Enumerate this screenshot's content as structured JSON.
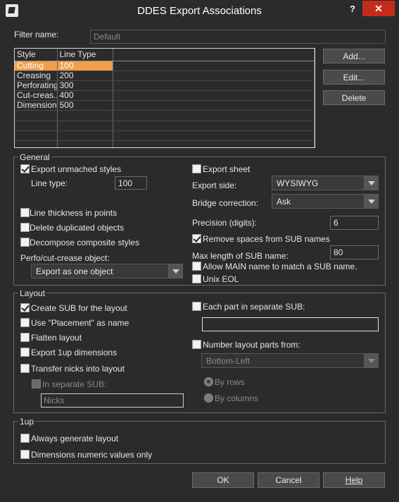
{
  "window": {
    "title": "DDES Export Associations",
    "help_glyph": "?",
    "close_glyph": "✕"
  },
  "filter": {
    "label": "Filter name:",
    "value": "Default"
  },
  "table": {
    "headers": [
      "Style",
      "Line Type"
    ],
    "rows": [
      {
        "style": "Cutting",
        "line_type": "100",
        "selected": true
      },
      {
        "style": "Creasing",
        "line_type": "200"
      },
      {
        "style": "Perforating",
        "line_type": "300"
      },
      {
        "style": "Cut-creas...",
        "line_type": "400"
      },
      {
        "style": "Dimensions",
        "line_type": "500"
      }
    ]
  },
  "side_buttons": {
    "add": "Add...",
    "edit": "Edit...",
    "delete": "Delete"
  },
  "general": {
    "title": "General",
    "export_unmatched": "Export unmached styles",
    "line_type_label": "Line type:",
    "line_type_value": "100",
    "line_thickness": "Line thickness in points",
    "delete_duplicated": "Delete duplicated objects",
    "decompose": "Decompose composite styles",
    "perfo_label": "Perfo/cut-crease object:",
    "perfo_value": "Export as one object",
    "export_sheet": "Export sheet",
    "export_side_label": "Export side:",
    "export_side_value": "WYSIWYG",
    "bridge_label": "Bridge correction:",
    "bridge_value": "Ask",
    "precision_label": "Precision (digits):",
    "precision_value": "6",
    "remove_spaces": "Remove spaces from SUB names",
    "max_length_label": "Max length of SUB name:",
    "max_length_value": "80",
    "allow_main": "Allow MAIN name to match a SUB name.",
    "unix_eol": "Unix EOL"
  },
  "layout": {
    "title": "Layout",
    "create_sub": "Create SUB for the layout",
    "use_placement": "Use \"Placement\" as name",
    "flatten": "Flatten layout",
    "export_1up": "Export 1up dimensions",
    "transfer_nicks": "Transfer nicks into layout",
    "in_separate_sub": "In separate SUB:",
    "nicks_value": "Nicks",
    "each_part": "Each part in separate SUB:",
    "each_part_value": "",
    "number_parts": "Number layout parts from:",
    "number_from_value": "Bottom-Left",
    "by_rows": "By rows",
    "by_columns": "By columns"
  },
  "oneup": {
    "title": "1up",
    "always_generate": "Always generate layout",
    "dimensions_numeric": "Dimensions numeric values only"
  },
  "footer": {
    "ok": "OK",
    "cancel": "Cancel",
    "help": "Help"
  }
}
